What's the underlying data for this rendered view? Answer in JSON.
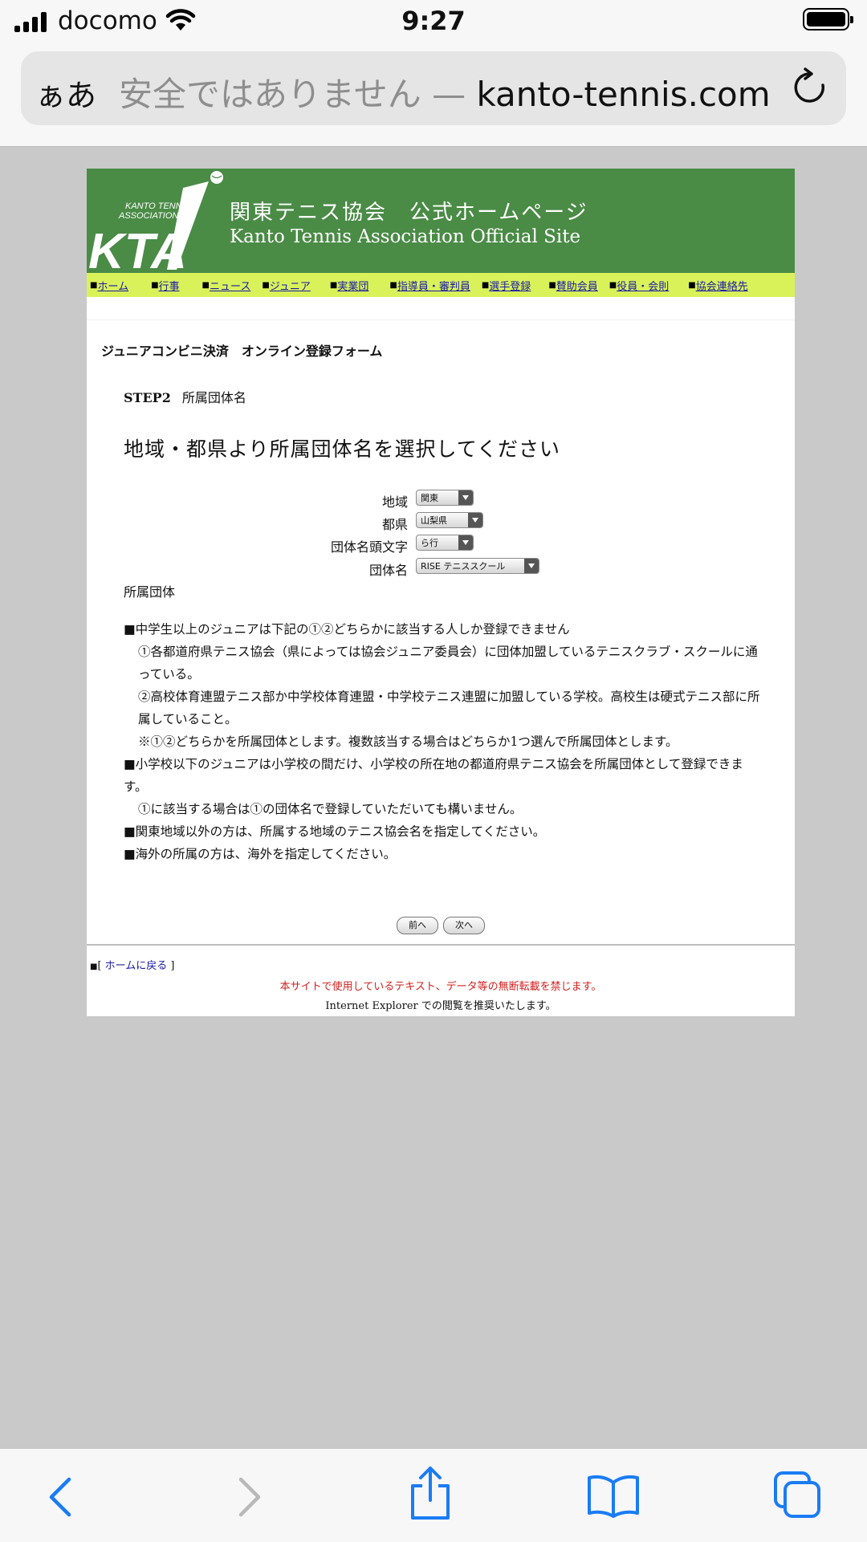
{
  "status": {
    "carrier": "docomo",
    "time": "9:27"
  },
  "browser": {
    "text_size_label": "ぁあ",
    "insecure_label": "安全ではありません —",
    "domain": "kanto-tennis.com"
  },
  "site": {
    "logo_text": "KANTO TENNIS ASSOCIATION",
    "logo_mark": "KTA",
    "title_jp": "関東テニス協会　公式ホームページ",
    "title_en": "Kanto Tennis Association Official Site"
  },
  "nav": [
    "ホーム",
    "行事",
    "ニュース",
    "ジュニア",
    "実業団",
    "指導員・審判員",
    "選手登録",
    "賛助会員",
    "役員・会則",
    "協会連絡先"
  ],
  "form": {
    "title": "ジュニアコンビニ決済　オンライン登録フォーム",
    "step_label": "STEP2",
    "step_name": "所属団体名",
    "heading": "地域・都県より所属団体名を選択してください",
    "fields": [
      {
        "label": "地域",
        "value": "関東"
      },
      {
        "label": "都県",
        "value": "山梨県"
      },
      {
        "label": "団体名頭文字",
        "value": "ら行"
      },
      {
        "label": "団体名",
        "value": "RISE テニススクール"
      }
    ],
    "affiliation_label": "所属団体"
  },
  "notes": [
    "■中学生以上のジュニアは下記の①②どちらかに該当する人しか登録できません",
    "①各都道府県テニス協会（県によっては協会ジュニア委員会）に団体加盟しているテニスクラブ・スクールに通っている。",
    "②高校体育連盟テニス部か中学校体育連盟・中学校テニス連盟に加盟している学校。高校生は硬式テニス部に所属していること。",
    "※①②どちらかを所属団体とします。複数該当する場合はどちらか1つ選んで所属団体とします。",
    "■小学校以下のジュニアは小学校の間だけ、小学校の所在地の都道府県テニス協会を所属団体として登録できます。",
    "①に該当する場合は①の団体名で登録していただいても構いません。",
    "■関東地域以外の方は、所属する地域のテニス協会名を指定してください。",
    "■海外の所属の方は、海外を指定してください。"
  ],
  "buttons": {
    "prev": "前へ",
    "next": "次へ"
  },
  "footer": {
    "home_link": "ホームに戻る",
    "copyright": "本サイトで使用しているテキスト、データ等の無断転載を禁じます。",
    "ie_notice": "Internet Explorer での閲覧を推奨いたします。"
  },
  "colors": {
    "banner": "#4a8b46",
    "navbar": "#d9f25a",
    "link": "#1a1aa8",
    "ios_blue": "#1a7cf5"
  },
  "icons": [
    "signal-icon",
    "wifi-icon",
    "battery-icon",
    "reload-icon",
    "back-icon",
    "forward-icon",
    "share-icon",
    "bookmarks-icon",
    "tabs-icon"
  ]
}
